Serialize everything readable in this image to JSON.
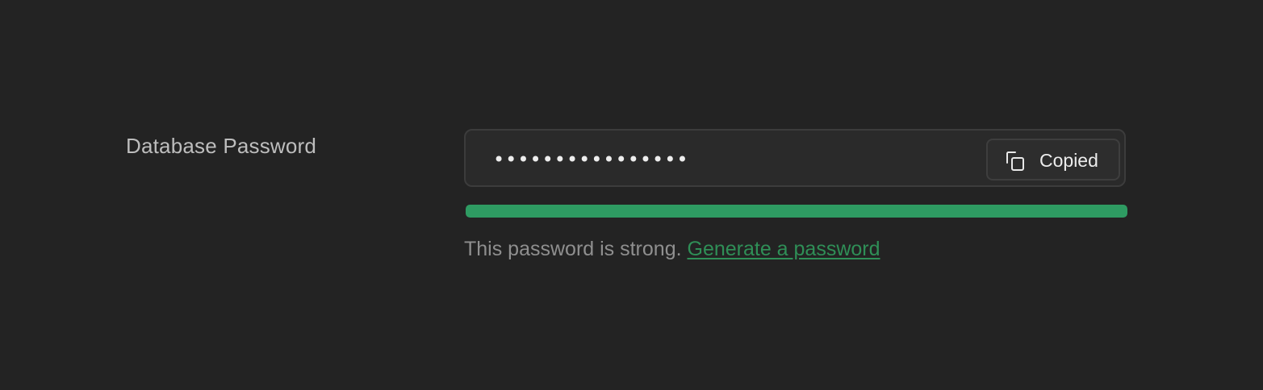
{
  "form": {
    "label": "Database Password",
    "password_masked": "••••••••••••••••",
    "copy_button_label": "Copied",
    "copy_icon": "copy-icon",
    "strength_fraction": 1.0,
    "strength_color": "#2e9b62",
    "strength_message": "This password is strong.",
    "generate_link_label": "Generate a password"
  },
  "colors": {
    "background": "#232323",
    "accent": "#2e9b62",
    "link": "#2f8f57"
  }
}
